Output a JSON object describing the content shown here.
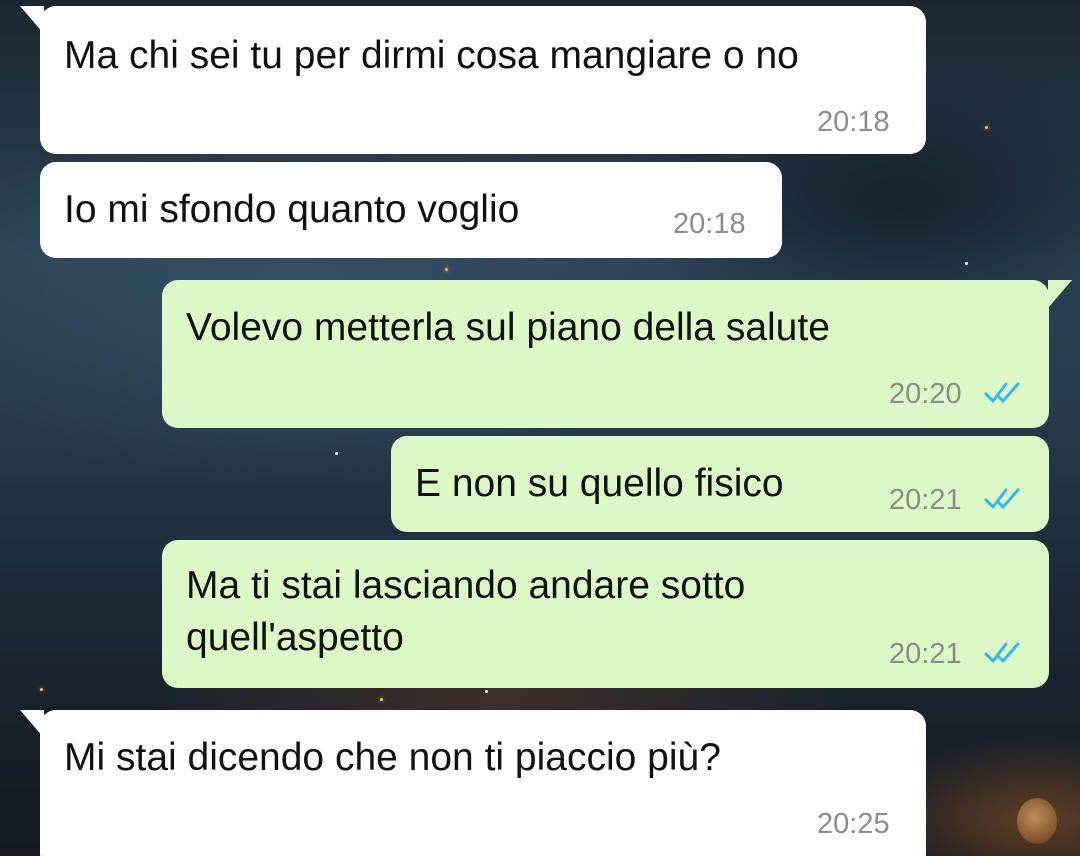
{
  "conversation": {
    "messages": [
      {
        "direction": "incoming",
        "text": "Ma chi sei tu per dirmi cosa mangiare o no",
        "time": "20:18"
      },
      {
        "direction": "incoming",
        "text": "Io mi sfondo quanto voglio",
        "time": "20:18"
      },
      {
        "direction": "outgoing",
        "text": "Volevo metterla sul piano della salute",
        "time": "20:20",
        "status": "read"
      },
      {
        "direction": "outgoing",
        "text": "E non su quello fisico",
        "time": "20:21",
        "status": "read"
      },
      {
        "direction": "outgoing",
        "text_line1": "Ma ti stai lasciando andare sotto",
        "text_line2": "quell'aspetto",
        "time": "20:21",
        "status": "read"
      },
      {
        "direction": "incoming",
        "text": "Mi stai dicendo che non ti piaccio più?",
        "time": "20:25"
      }
    ]
  },
  "colors": {
    "incoming_bubble": "#ffffff",
    "outgoing_bubble": "#dcf8c6",
    "read_ticks": "#34b7f1",
    "timestamp": "#8c8c8c"
  },
  "icons": {
    "read_receipt": "double-check-icon"
  }
}
